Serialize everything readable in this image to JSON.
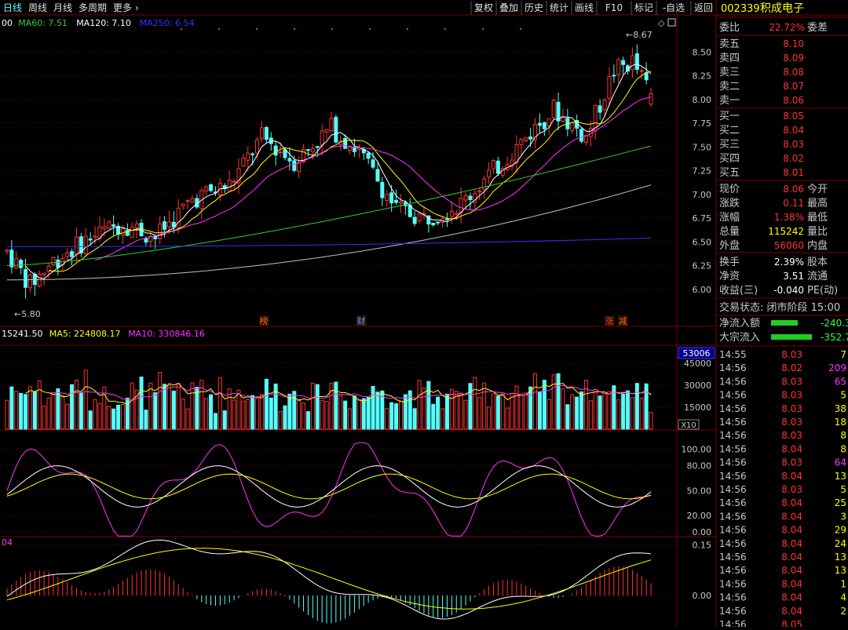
{
  "toolbar": {
    "periods": [
      "日线",
      "周线",
      "月线",
      "多周期",
      "更多"
    ],
    "active_period": "日线",
    "right_buttons": [
      "复权",
      "叠加",
      "历史",
      "统计",
      "画线",
      "F10",
      "标记",
      "-自选",
      "返回"
    ]
  },
  "stock": {
    "code": "002339",
    "name": "积成电子"
  },
  "colors": {
    "up": "#ff3333",
    "down": "#54ffff",
    "ma5": "#ffffff",
    "ma10": "#ffff00",
    "ma20": "#ff33ff",
    "ma60": "#33cc33",
    "ma120": "#c0c0c0",
    "ma250": "#3333ff",
    "grid": "#7a0000"
  },
  "main_legend": [
    {
      "text": "00",
      "color": "#ffffff"
    },
    {
      "text": "MA60: 7.51",
      "color": "#33cc33"
    },
    {
      "text": "MA120: 7.10",
      "color": "#ffffff"
    },
    {
      "text": "MA250: 6.54",
      "color": "#3333ff"
    }
  ],
  "vol_legend": [
    {
      "text": "15241.50",
      "color": "#ffffff"
    },
    {
      "text": "MA5: 224808.17",
      "color": "#ffff00"
    },
    {
      "text": "MA10: 330846.16",
      "color": "#ff33ff"
    }
  ],
  "macd_legend": "04",
  "price_axis": [
    "8.50",
    "8.25",
    "8.00",
    "7.75",
    "7.50",
    "7.25",
    "7.00",
    "6.75",
    "6.50",
    "6.25",
    "6.00"
  ],
  "high_label": "8.67",
  "low_label": "5.80",
  "event_tags": [
    {
      "text": "榜",
      "color": "#ff6600"
    },
    {
      "text": "财",
      "color": "#6699ff"
    },
    {
      "text": "涨",
      "color": "#ff3333"
    },
    {
      "text": "减",
      "color": "#ff6600"
    }
  ],
  "vol_axis": {
    "top_badge": "53006",
    "ticks": [
      "45000",
      "30000",
      "15000"
    ],
    "unit": "X10"
  },
  "kdj_axis": [
    "100.00",
    "80.00",
    "50.00",
    "20.00",
    "0.00"
  ],
  "macd_axis": [
    "0.15",
    "0.00"
  ],
  "chart_data": {
    "type": "candlestick",
    "title": "",
    "ylim": [
      5.8,
      8.7
    ],
    "note": "daily K-line of 002339 with MA lines, volume, KDJ and MACD sub-panels",
    "high": 8.67,
    "low": 5.8,
    "last_close": 8.06,
    "ma60": 7.51,
    "ma120": 7.1,
    "ma250": 6.54
  },
  "quote": {
    "weibi": {
      "label": "委比",
      "value": "22.72%",
      "label2": "委差"
    },
    "sells": [
      {
        "label": "卖五",
        "price": "8.10"
      },
      {
        "label": "卖四",
        "price": "8.09"
      },
      {
        "label": "卖三",
        "price": "8.08"
      },
      {
        "label": "卖二",
        "price": "8.07"
      },
      {
        "label": "卖一",
        "price": "8.06"
      }
    ],
    "buys": [
      {
        "label": "买一",
        "price": "8.05"
      },
      {
        "label": "买二",
        "price": "8.04"
      },
      {
        "label": "买三",
        "price": "8.03"
      },
      {
        "label": "买四",
        "price": "8.02"
      },
      {
        "label": "买五",
        "price": "8.01"
      }
    ],
    "stats": [
      {
        "label": "现价",
        "value": "8.06",
        "label2": "今开",
        "color": "#ff3333"
      },
      {
        "label": "涨跌",
        "value": "0.11",
        "label2": "最高",
        "color": "#ff3333"
      },
      {
        "label": "涨幅",
        "value": "1.38%",
        "label2": "最低",
        "color": "#ff3333"
      },
      {
        "label": "总量",
        "value": "115242",
        "label2": "量比",
        "color": "#ffff00"
      },
      {
        "label": "外盘",
        "value": "56060",
        "label2": "内盘",
        "color": "#ff3333"
      }
    ],
    "stats2": [
      {
        "label": "换手",
        "value": "2.39%",
        "label2": "股本",
        "color": "#ffffff"
      },
      {
        "label": "净资",
        "value": "3.51",
        "label2": "流通",
        "color": "#ffffff"
      },
      {
        "label": "收益(三)",
        "value": "-0.040",
        "label2": "PE(动)",
        "color": "#ffffff"
      }
    ],
    "status": "交易状态: 闭市阶段 15:00",
    "flows": [
      {
        "label": "净流入额",
        "value": "-240.3"
      },
      {
        "label": "大宗流入",
        "value": "-352.7"
      }
    ]
  },
  "ticks": [
    {
      "time": "14:55",
      "price": "8.03",
      "vol": "7"
    },
    {
      "time": "14:56",
      "price": "8.02",
      "vol": "209"
    },
    {
      "time": "14:56",
      "price": "8.03",
      "vol": "65"
    },
    {
      "time": "14:56",
      "price": "8.03",
      "vol": "5"
    },
    {
      "time": "14:56",
      "price": "8.03",
      "vol": "38"
    },
    {
      "time": "14:56",
      "price": "8.03",
      "vol": "18"
    },
    {
      "time": "14:56",
      "price": "8.03",
      "vol": "8"
    },
    {
      "time": "14:56",
      "price": "8.04",
      "vol": "8"
    },
    {
      "time": "14:56",
      "price": "8.03",
      "vol": "64"
    },
    {
      "time": "14:56",
      "price": "8.04",
      "vol": "13"
    },
    {
      "time": "14:56",
      "price": "8.03",
      "vol": "5"
    },
    {
      "time": "14:56",
      "price": "8.04",
      "vol": "25"
    },
    {
      "time": "14:56",
      "price": "8.04",
      "vol": "3"
    },
    {
      "time": "14:56",
      "price": "8.04",
      "vol": "29"
    },
    {
      "time": "14:56",
      "price": "8.04",
      "vol": "24"
    },
    {
      "time": "14:56",
      "price": "8.04",
      "vol": "13"
    },
    {
      "time": "14:56",
      "price": "8.04",
      "vol": "13"
    },
    {
      "time": "14:56",
      "price": "8.04",
      "vol": "1"
    },
    {
      "time": "14:56",
      "price": "8.04",
      "vol": "4"
    },
    {
      "time": "14:56",
      "price": "8.04",
      "vol": "2"
    },
    {
      "time": "14:56",
      "price": "8.05",
      "vol": ""
    }
  ]
}
